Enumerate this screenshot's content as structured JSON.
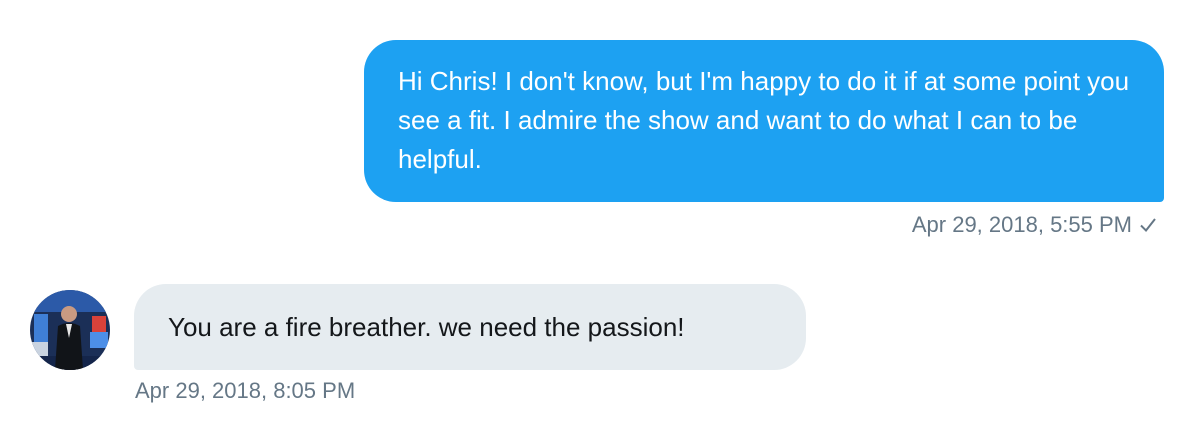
{
  "colors": {
    "sent_bubble": "#1da1f2",
    "received_bubble": "#e6ecf0",
    "timestamp_text": "#657786",
    "received_text": "#14171a"
  },
  "messages": [
    {
      "direction": "sent",
      "text": "Hi Chris! I don't know, but I'm happy to do it if at some point you see a fit. I admire the show and want to do what I can to be helpful.",
      "timestamp": "Apr 29, 2018, 5:55 PM",
      "status_icon": "check-icon"
    },
    {
      "direction": "received",
      "text": "You are a fire breather. we need the passion!",
      "timestamp": "Apr 29, 2018, 8:05 PM",
      "avatar_icon": "avatar"
    }
  ]
}
